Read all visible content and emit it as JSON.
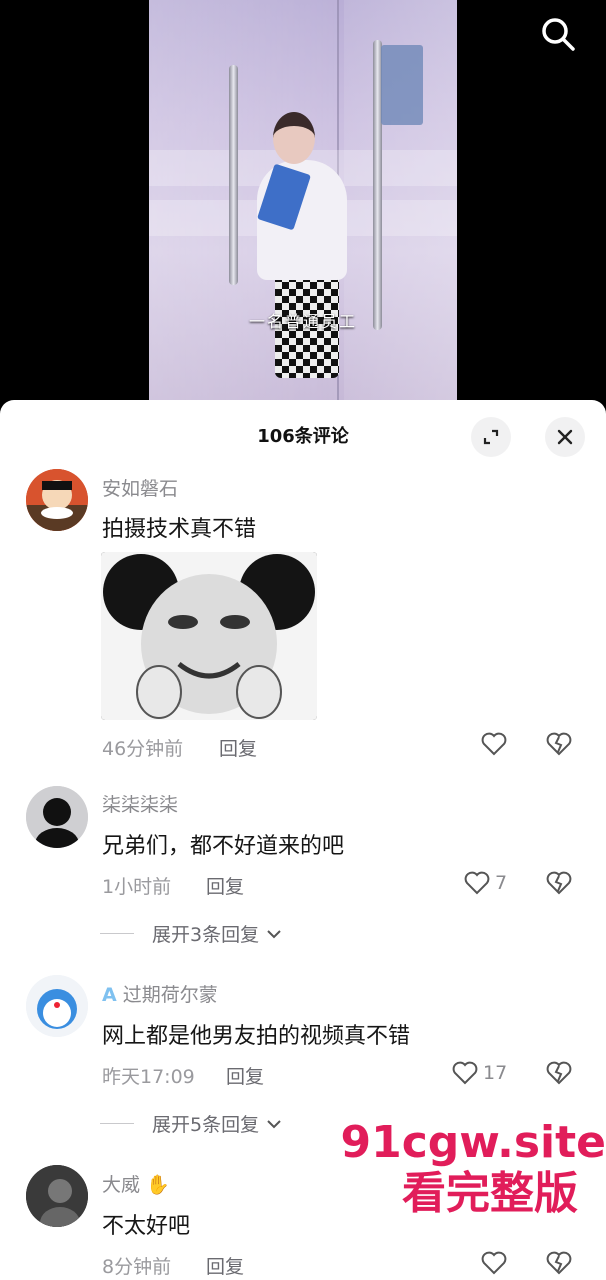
{
  "video": {
    "caption": "一名普通员工"
  },
  "sheet": {
    "title": "106条评论"
  },
  "comments": [
    {
      "username": "安如磐石",
      "text": "拍摄技术真不错",
      "time": "46分钟前",
      "reply": "回复",
      "likes": ""
    },
    {
      "username": "柒柒柒柒",
      "text": "兄弟们，都不好道来的吧",
      "time": "1小时前",
      "reply": "回复",
      "likes": "7",
      "expand": "展开3条回复"
    },
    {
      "username": "过期荷尔蒙",
      "text": "网上都是他男友拍的视频真不错",
      "time": "昨天17:09",
      "reply": "回复",
      "likes": "17",
      "expand": "展开5条回复"
    },
    {
      "username": "大威",
      "text": "不太好吧",
      "time": "8分钟前",
      "reply": "回复",
      "likes": ""
    }
  ],
  "watermark": {
    "line1": "91cgw.site",
    "line2": "看完整版"
  },
  "colors": {
    "watermark": "#e11d5a",
    "username": "#8a8a8e",
    "text": "#161616"
  },
  "icons": [
    "search-icon",
    "expand-icon",
    "close-icon",
    "heart-icon",
    "broken-heart-icon",
    "chevron-down-icon",
    "hand-emoji-icon",
    "verified-a-icon"
  ]
}
